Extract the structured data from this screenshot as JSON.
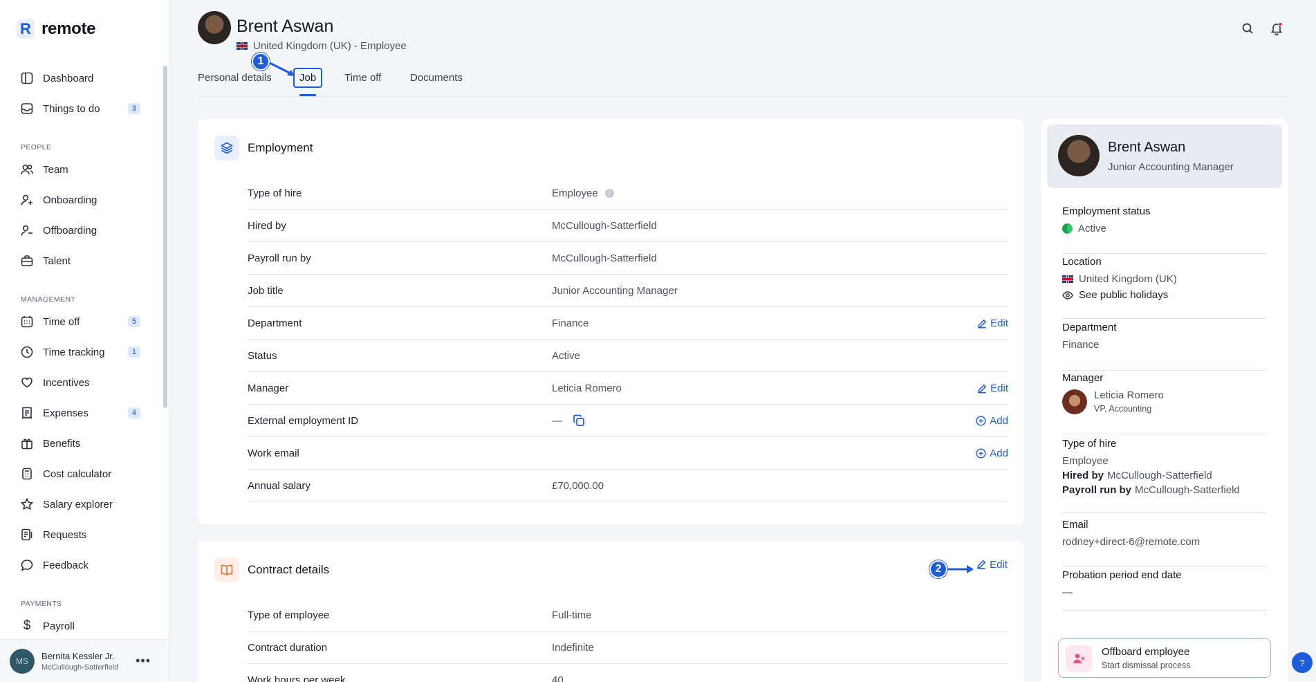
{
  "brand": {
    "name": "remote",
    "mark": "R",
    "accent": "#1c5bdb"
  },
  "sidebar": {
    "items_top": [
      {
        "label": "Dashboard",
        "icon": "dashboard-icon"
      },
      {
        "label": "Things to do",
        "icon": "inbox-icon",
        "badge": "3"
      }
    ],
    "people_title": "PEOPLE",
    "people": [
      {
        "label": "Team",
        "icon": "team-icon"
      },
      {
        "label": "Onboarding",
        "icon": "user-plus-icon"
      },
      {
        "label": "Offboarding",
        "icon": "user-minus-icon"
      },
      {
        "label": "Talent",
        "icon": "briefcase-icon"
      }
    ],
    "management_title": "MANAGEMENT",
    "management": [
      {
        "label": "Time off",
        "icon": "calendar-icon",
        "badge": "5"
      },
      {
        "label": "Time tracking",
        "icon": "clock-icon",
        "badge": "1"
      },
      {
        "label": "Incentives",
        "icon": "heart-icon"
      },
      {
        "label": "Expenses",
        "icon": "receipt-icon",
        "badge": "4"
      },
      {
        "label": "Benefits",
        "icon": "gift-icon"
      },
      {
        "label": "Cost calculator",
        "icon": "calculator-icon"
      },
      {
        "label": "Salary explorer",
        "icon": "star-icon"
      },
      {
        "label": "Requests",
        "icon": "document-icon"
      },
      {
        "label": "Feedback",
        "icon": "chat-icon"
      }
    ],
    "payments_title": "PAYMENTS",
    "payments": [
      {
        "label": "Payroll",
        "icon": "dollar-icon"
      }
    ],
    "user": {
      "initials": "MS",
      "name": "Bernita Kessler Jr.",
      "company": "McCullough-Satterfield"
    }
  },
  "header": {
    "name": "Brent Aswan",
    "subtitle": "United Kingdom (UK) - Employee"
  },
  "tabs": [
    "Personal details",
    "Job",
    "Time off",
    "Documents"
  ],
  "annotations": {
    "step1": "1",
    "step2": "2"
  },
  "employment": {
    "title": "Employment",
    "rows": [
      {
        "key": "Type of hire",
        "value": "Employee"
      },
      {
        "key": "Hired by",
        "value": "McCullough-Satterfield"
      },
      {
        "key": "Payroll run by",
        "value": "McCullough-Satterfield"
      },
      {
        "key": "Job title",
        "value": "Junior Accounting Manager"
      },
      {
        "key": "Department",
        "value": "Finance",
        "action": "Edit"
      },
      {
        "key": "Status",
        "value": "Active"
      },
      {
        "key": "Manager",
        "value": "Leticia Romero",
        "action": "Edit"
      },
      {
        "key": "External employment ID",
        "value": "—",
        "action": "Add"
      },
      {
        "key": "Work email",
        "value": "",
        "action": "Add"
      },
      {
        "key": "Annual salary",
        "value": "£70,000.00"
      }
    ]
  },
  "contract": {
    "title": "Contract details",
    "edit": "Edit",
    "rows": [
      {
        "key": "Type of employee",
        "value": "Full-time"
      },
      {
        "key": "Contract duration",
        "value": "Indefinite"
      },
      {
        "key": "Work hours per week",
        "value": "40"
      }
    ]
  },
  "profile": {
    "name": "Brent Aswan",
    "title": "Junior Accounting Manager",
    "employment_status_label": "Employment status",
    "employment_status": "Active",
    "location_label": "Location",
    "location": "United Kingdom (UK)",
    "holidays_link": "See public holidays",
    "department_label": "Department",
    "department": "Finance",
    "manager_label": "Manager",
    "manager_name": "Leticia Romero",
    "manager_title": "VP, Accounting",
    "type_label": "Type of hire",
    "type": "Employee",
    "hired_by_label": "Hired by",
    "hired_by": "McCullough-Satterfield",
    "payroll_label": "Payroll run by",
    "payroll": "McCullough-Satterfield",
    "email_label": "Email",
    "email": "rodney+direct-6@remote.com",
    "probation_label": "Probation period end date",
    "probation": "—"
  },
  "offboard": {
    "title": "Offboard employee",
    "subtitle": "Start dismissal process"
  },
  "help_label": "?"
}
